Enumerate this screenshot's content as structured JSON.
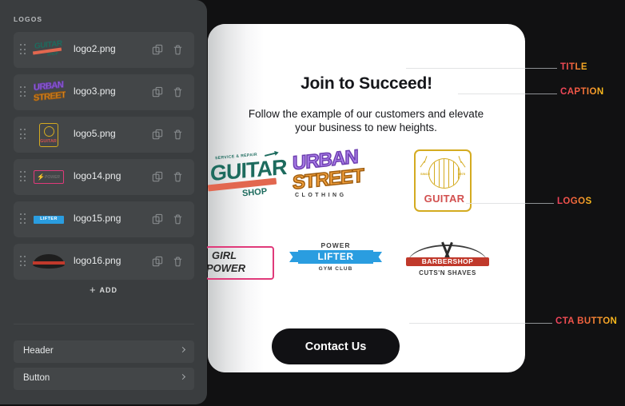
{
  "sidebar": {
    "section_header": "LOGOS",
    "items": [
      {
        "name": "logo2.png",
        "thumb": "guitar-shop"
      },
      {
        "name": "logo3.png",
        "thumb": "urban-street"
      },
      {
        "name": "logo5.png",
        "thumb": "guitar-badge"
      },
      {
        "name": "logo14.png",
        "thumb": "girl-power"
      },
      {
        "name": "logo15.png",
        "thumb": "power-lifter"
      },
      {
        "name": "logo16.png",
        "thumb": "barbershop"
      }
    ],
    "add_label": "ADD",
    "add_plus": "+",
    "sections": [
      {
        "label": "Header"
      },
      {
        "label": "Button"
      }
    ],
    "icons": {
      "drag": "drag-handle-icon",
      "copy": "copy-icon",
      "trash": "trash-icon",
      "chevron": "chevron-right-icon"
    },
    "colors": {
      "panel": "#3a3d3f",
      "row": "#434648",
      "text": "#e9ebec"
    }
  },
  "card": {
    "title": "Join to Succeed!",
    "caption": "Follow the example of our customers and elevate your business to new heights.",
    "cta_label": "Contact Us",
    "logos": [
      {
        "id": "guitar-shop",
        "top": "SERVICE & REPAIR",
        "main": "GUITAR",
        "sub": "SHOP"
      },
      {
        "id": "urban-street",
        "line1": "URBAN",
        "line2": "STREET",
        "line3": "CLOTHING"
      },
      {
        "id": "guitar-badge",
        "since": "SINCE",
        "year": "1975",
        "text": "GUITAR"
      },
      {
        "id": "girl-power",
        "line1": "GIRL",
        "line2": "POWER"
      },
      {
        "id": "power-lifter",
        "top": "POWER",
        "mid": "LIFTER",
        "bottom": "GYM CLUB"
      },
      {
        "id": "barbershop",
        "main": "BARBERSHOP",
        "sub": "CUTS'N SHAVES"
      }
    ],
    "colors": {
      "background": "#ffffff",
      "cta_bg": "#111114",
      "cta_text": "#ffffff"
    }
  },
  "annotations": [
    {
      "label": "TITLE"
    },
    {
      "label": "CAPTION"
    },
    {
      "label": "LOGOS"
    },
    {
      "label": "CTA BUTTON"
    }
  ],
  "theme": {
    "app_background": "#111112",
    "accent_gradient_start": "#f1425e",
    "accent_gradient_end": "#fdc217"
  }
}
